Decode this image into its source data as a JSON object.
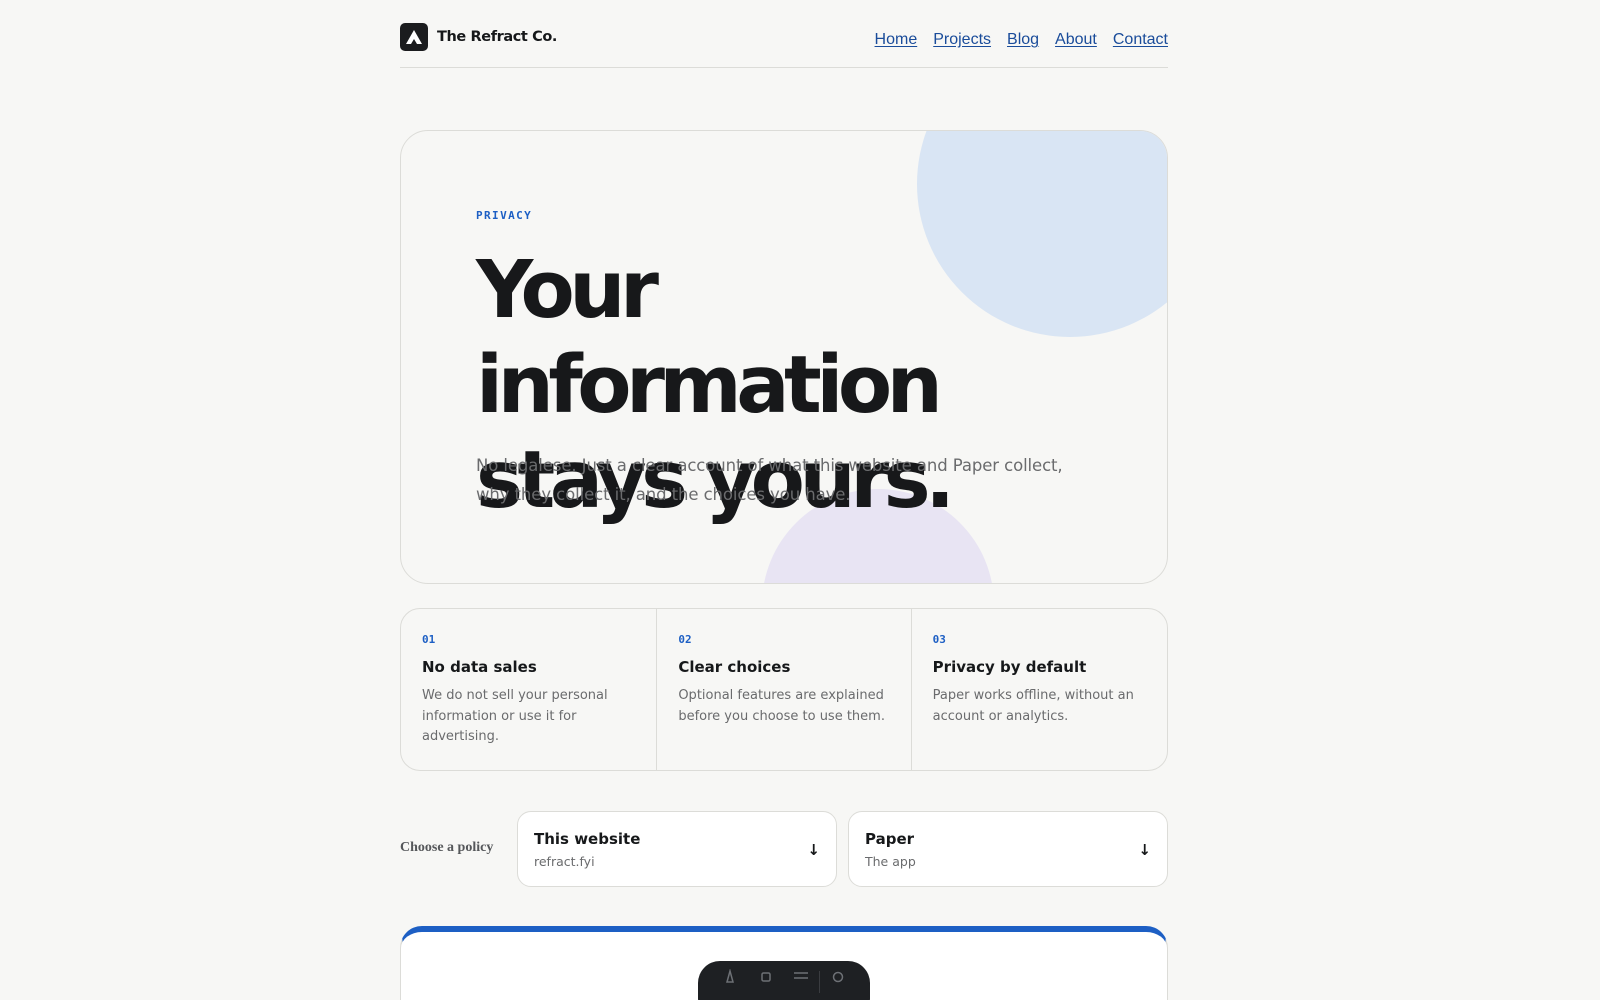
{
  "header": {
    "brand": "The Refract Co.",
    "logo_icon": "mountain-icon",
    "nav": [
      {
        "label": "Home"
      },
      {
        "label": "Projects"
      },
      {
        "label": "Blog"
      },
      {
        "label": "About"
      },
      {
        "label": "Contact"
      }
    ]
  },
  "hero": {
    "eyebrow": "PRIVACY",
    "headline_line1": "Your information",
    "headline_line2": "stays yours.",
    "lede": "No legalese. Just a clear account of what this website and Paper collect, why they collect it, and the choices you have."
  },
  "features": [
    {
      "num": "01",
      "title": "No data sales",
      "text": "We do not sell your personal information or use it for advertising."
    },
    {
      "num": "02",
      "title": "Clear choices",
      "text": "Optional features are explained before you choose to use them."
    },
    {
      "num": "03",
      "title": "Privacy by default",
      "text": "Paper works offline, without an account or analytics."
    }
  ],
  "chooser": {
    "label": "Choose a policy",
    "options": [
      {
        "title": "This website",
        "sub": "refract.fyi",
        "arrow": "↓"
      },
      {
        "title": "Paper",
        "sub": "The app",
        "arrow": "↓"
      }
    ]
  },
  "colors": {
    "accent": "#1d5fc4",
    "link": "#1a4c9a",
    "background": "#f7f7f5",
    "blob_blue": "#d9e5f4",
    "blob_purple": "#e8e4f3"
  }
}
